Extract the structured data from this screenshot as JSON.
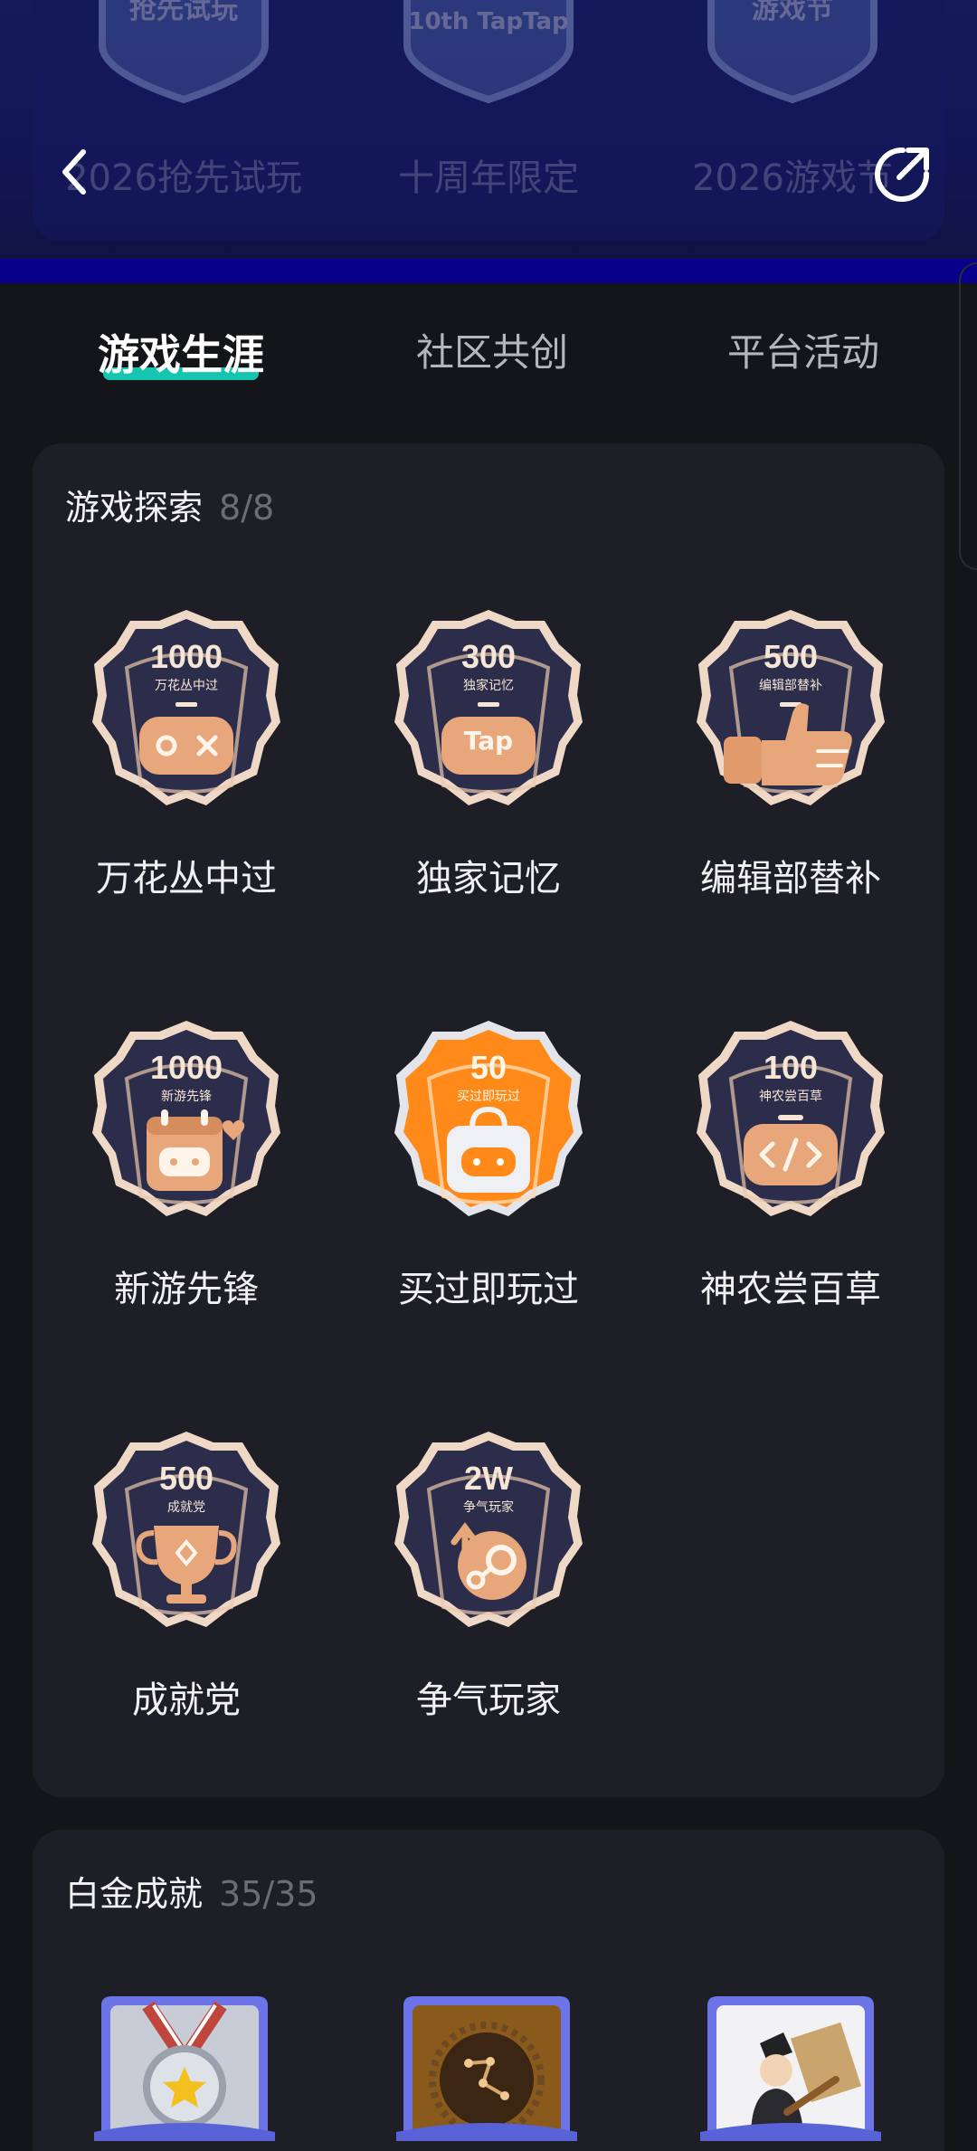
{
  "header": {
    "top_badges": [
      {
        "label": "2026抢先试玩",
        "art_text": "抢先试玩"
      },
      {
        "label": "十周年限定",
        "art_text": "10th TapTap"
      },
      {
        "label": "2026游戏节",
        "art_text": "游戏节"
      }
    ],
    "back_icon": "chevron-left-icon",
    "share_icon": "share-icon"
  },
  "tabs": [
    {
      "label": "游戏生涯",
      "active": true
    },
    {
      "label": "社区共创",
      "active": false
    },
    {
      "label": "平台活动",
      "active": false
    }
  ],
  "sections": [
    {
      "title": "游戏探索",
      "count": "8/8",
      "badges": [
        {
          "number": "1000",
          "subtitle": "万花丛中过",
          "label": "万花丛中过",
          "icon": "gamepad-icon",
          "highlight": false
        },
        {
          "number": "300",
          "subtitle": "独家记忆",
          "label": "独家记忆",
          "icon": "tap-icon",
          "highlight": false
        },
        {
          "number": "500",
          "subtitle": "编辑部替补",
          "label": "编辑部替补",
          "icon": "thumbs-up-icon",
          "highlight": false
        },
        {
          "number": "1000",
          "subtitle": "新游先锋",
          "label": "新游先锋",
          "icon": "calendar-gamepad-icon",
          "highlight": false
        },
        {
          "number": "50",
          "subtitle": "买过即玩过",
          "label": "买过即玩过",
          "icon": "shopping-bag-gamepad-icon",
          "highlight": true
        },
        {
          "number": "100",
          "subtitle": "神农尝百草",
          "label": "神农尝百草",
          "icon": "code-icon",
          "highlight": false
        },
        {
          "number": "500",
          "subtitle": "成就党",
          "label": "成就党",
          "icon": "trophy-icon",
          "highlight": false
        },
        {
          "number": "2W",
          "subtitle": "争气玩家",
          "label": "争气玩家",
          "icon": "steam-icon",
          "highlight": false
        }
      ]
    },
    {
      "title": "白金成就",
      "count": "35/35",
      "badges": [
        {
          "icon": "medal-star-icon"
        },
        {
          "icon": "constellation-icon"
        },
        {
          "icon": "character-sign-icon"
        }
      ]
    }
  ],
  "colors": {
    "accent": "#16c5b0",
    "badge_dark": "#2c2d4a",
    "badge_gold": "#e7a77b",
    "badge_orange": "#ff8a1a",
    "section_bg": "#1e1f26"
  }
}
